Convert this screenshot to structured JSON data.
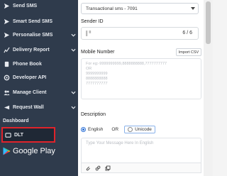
{
  "sidebar": {
    "items": [
      {
        "label": "Send SMS",
        "icon": "send-icon",
        "chevron": false
      },
      {
        "label": "Smart Send SMS",
        "icon": "send-icon",
        "chevron": false
      },
      {
        "label": "Personalise SMS",
        "icon": "send-icon",
        "chevron": true
      },
      {
        "label": "Delivery Report",
        "icon": "report-icon",
        "chevron": true
      },
      {
        "label": "Phone Book",
        "icon": "book-icon",
        "chevron": false
      },
      {
        "label": "Developer API",
        "icon": "api-icon",
        "chevron": false
      },
      {
        "label": "Manage Client",
        "icon": "users-icon",
        "chevron": true
      },
      {
        "label": "Request Wall",
        "icon": "wall-icon",
        "chevron": true
      },
      {
        "label": "Dashboard",
        "icon": "dashboard-icon",
        "chevron": false
      },
      {
        "label": "DLT",
        "icon": "dlt-icon",
        "chevron": false,
        "active": true
      }
    ],
    "google_play": "Google Play"
  },
  "form": {
    "route_select": "Transactional sms - 7091",
    "sender_id_label": "Sender ID",
    "sender_id_count": "6 / 6",
    "mobile_label": "Mobile Number",
    "import_csv": "Import CSV",
    "mobile_placeholder": "For eg:-9999999999,8888888888,7777777777\nOR\n9999999999\n8888888888\n7777777777",
    "description_label": "Description",
    "lang_english": "English",
    "lang_or": "OR",
    "lang_unicode": "Unicode",
    "message_placeholder": "Type Your Message Here In English"
  },
  "colors": {
    "sidebar_bg": "#2f3b4c",
    "active_outline": "#e0232b",
    "radio_accent": "#2a6fd6"
  }
}
